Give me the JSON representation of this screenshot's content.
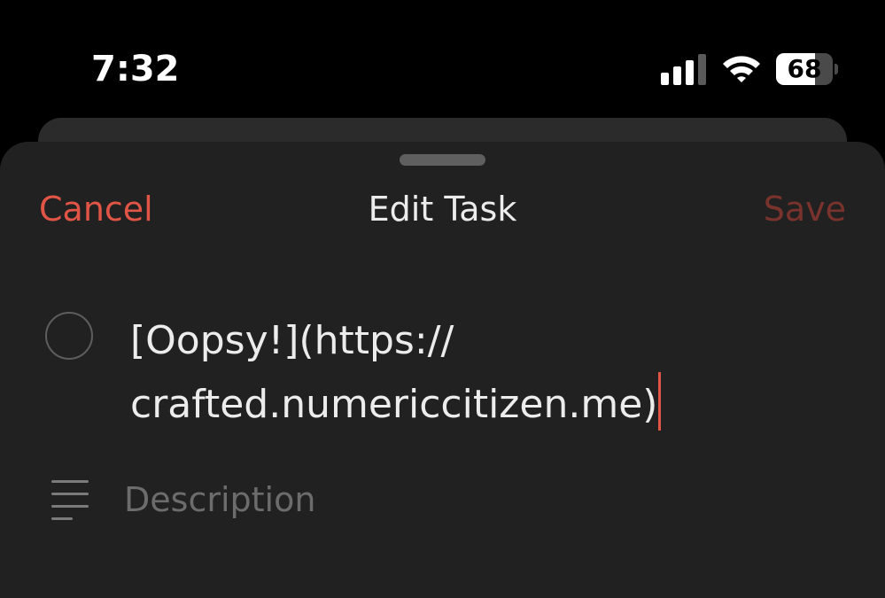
{
  "status_bar": {
    "time": "7:32",
    "battery_percent": "68",
    "battery_level": 0.68,
    "signal_bars_active": 3,
    "signal_bars_total": 4,
    "icons": [
      "signal-icon",
      "wifi-icon",
      "battery-icon"
    ]
  },
  "nav": {
    "cancel_label": "Cancel",
    "title": "Edit Task",
    "save_label": "Save"
  },
  "task": {
    "title_line1": "[Oopsy!](https://",
    "title_line2": "crafted.numericcitizen.me)"
  },
  "description": {
    "placeholder": "Description"
  },
  "colors": {
    "accent": "#e05545",
    "save_disabled": "#7a332c",
    "sheet_background": "#212121",
    "primary_text": "#ececec",
    "placeholder_text": "#6c6c6c"
  }
}
